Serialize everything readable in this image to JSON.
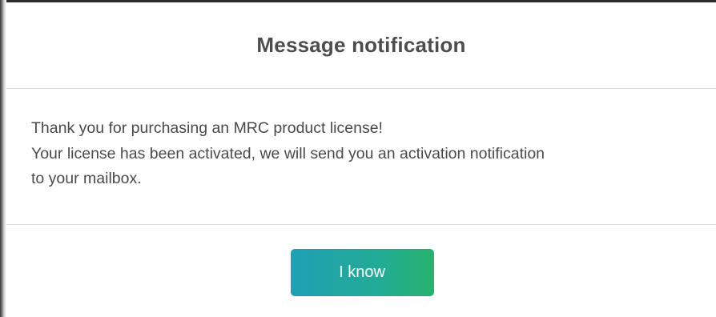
{
  "dialog": {
    "title": "Message notification",
    "message_lines": [
      "Thank you for purchasing an MRC product license!",
      "Your license has been activated, we will send you an activation notification",
      "to your mailbox."
    ],
    "confirm_label": "I know"
  },
  "colors": {
    "button_gradient_start": "#1fa0b4",
    "button_gradient_end": "#27b36f",
    "title_text": "#4d4d4d",
    "body_text": "#4a4a4a",
    "divider": "#dcdcdc"
  }
}
